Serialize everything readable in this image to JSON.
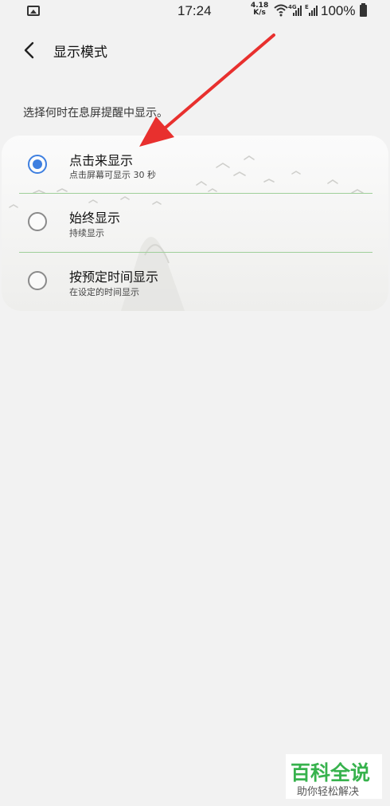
{
  "status_bar": {
    "time": "17:24",
    "net_speed_value": "4.18",
    "net_speed_unit": "K/s",
    "signal_tech_1": "4G",
    "signal_tech_2": "E",
    "battery_percent": "100%",
    "icons": [
      "gallery-icon",
      "wifi-icon",
      "signal-icon",
      "signal-icon",
      "battery-icon"
    ]
  },
  "header": {
    "back_icon": "chevron-left-icon",
    "title": "显示模式"
  },
  "hint": "选择何时在息屏提醒中显示。",
  "options": [
    {
      "title": "点击来显示",
      "subtitle": "点击屏幕可显示 30 秒",
      "selected": true
    },
    {
      "title": "始终显示",
      "subtitle": "持续显示",
      "selected": false
    },
    {
      "title": "按预定时间显示",
      "subtitle": "在设定的时间显示",
      "selected": false
    }
  ],
  "watermark": {
    "title": "百科全说",
    "subtitle": "助你轻松解决"
  },
  "colors": {
    "accent": "#3e7fe0",
    "annotation_arrow": "#e8302e",
    "divider": "#9fcf9a",
    "watermark_green": "#37b24d"
  }
}
